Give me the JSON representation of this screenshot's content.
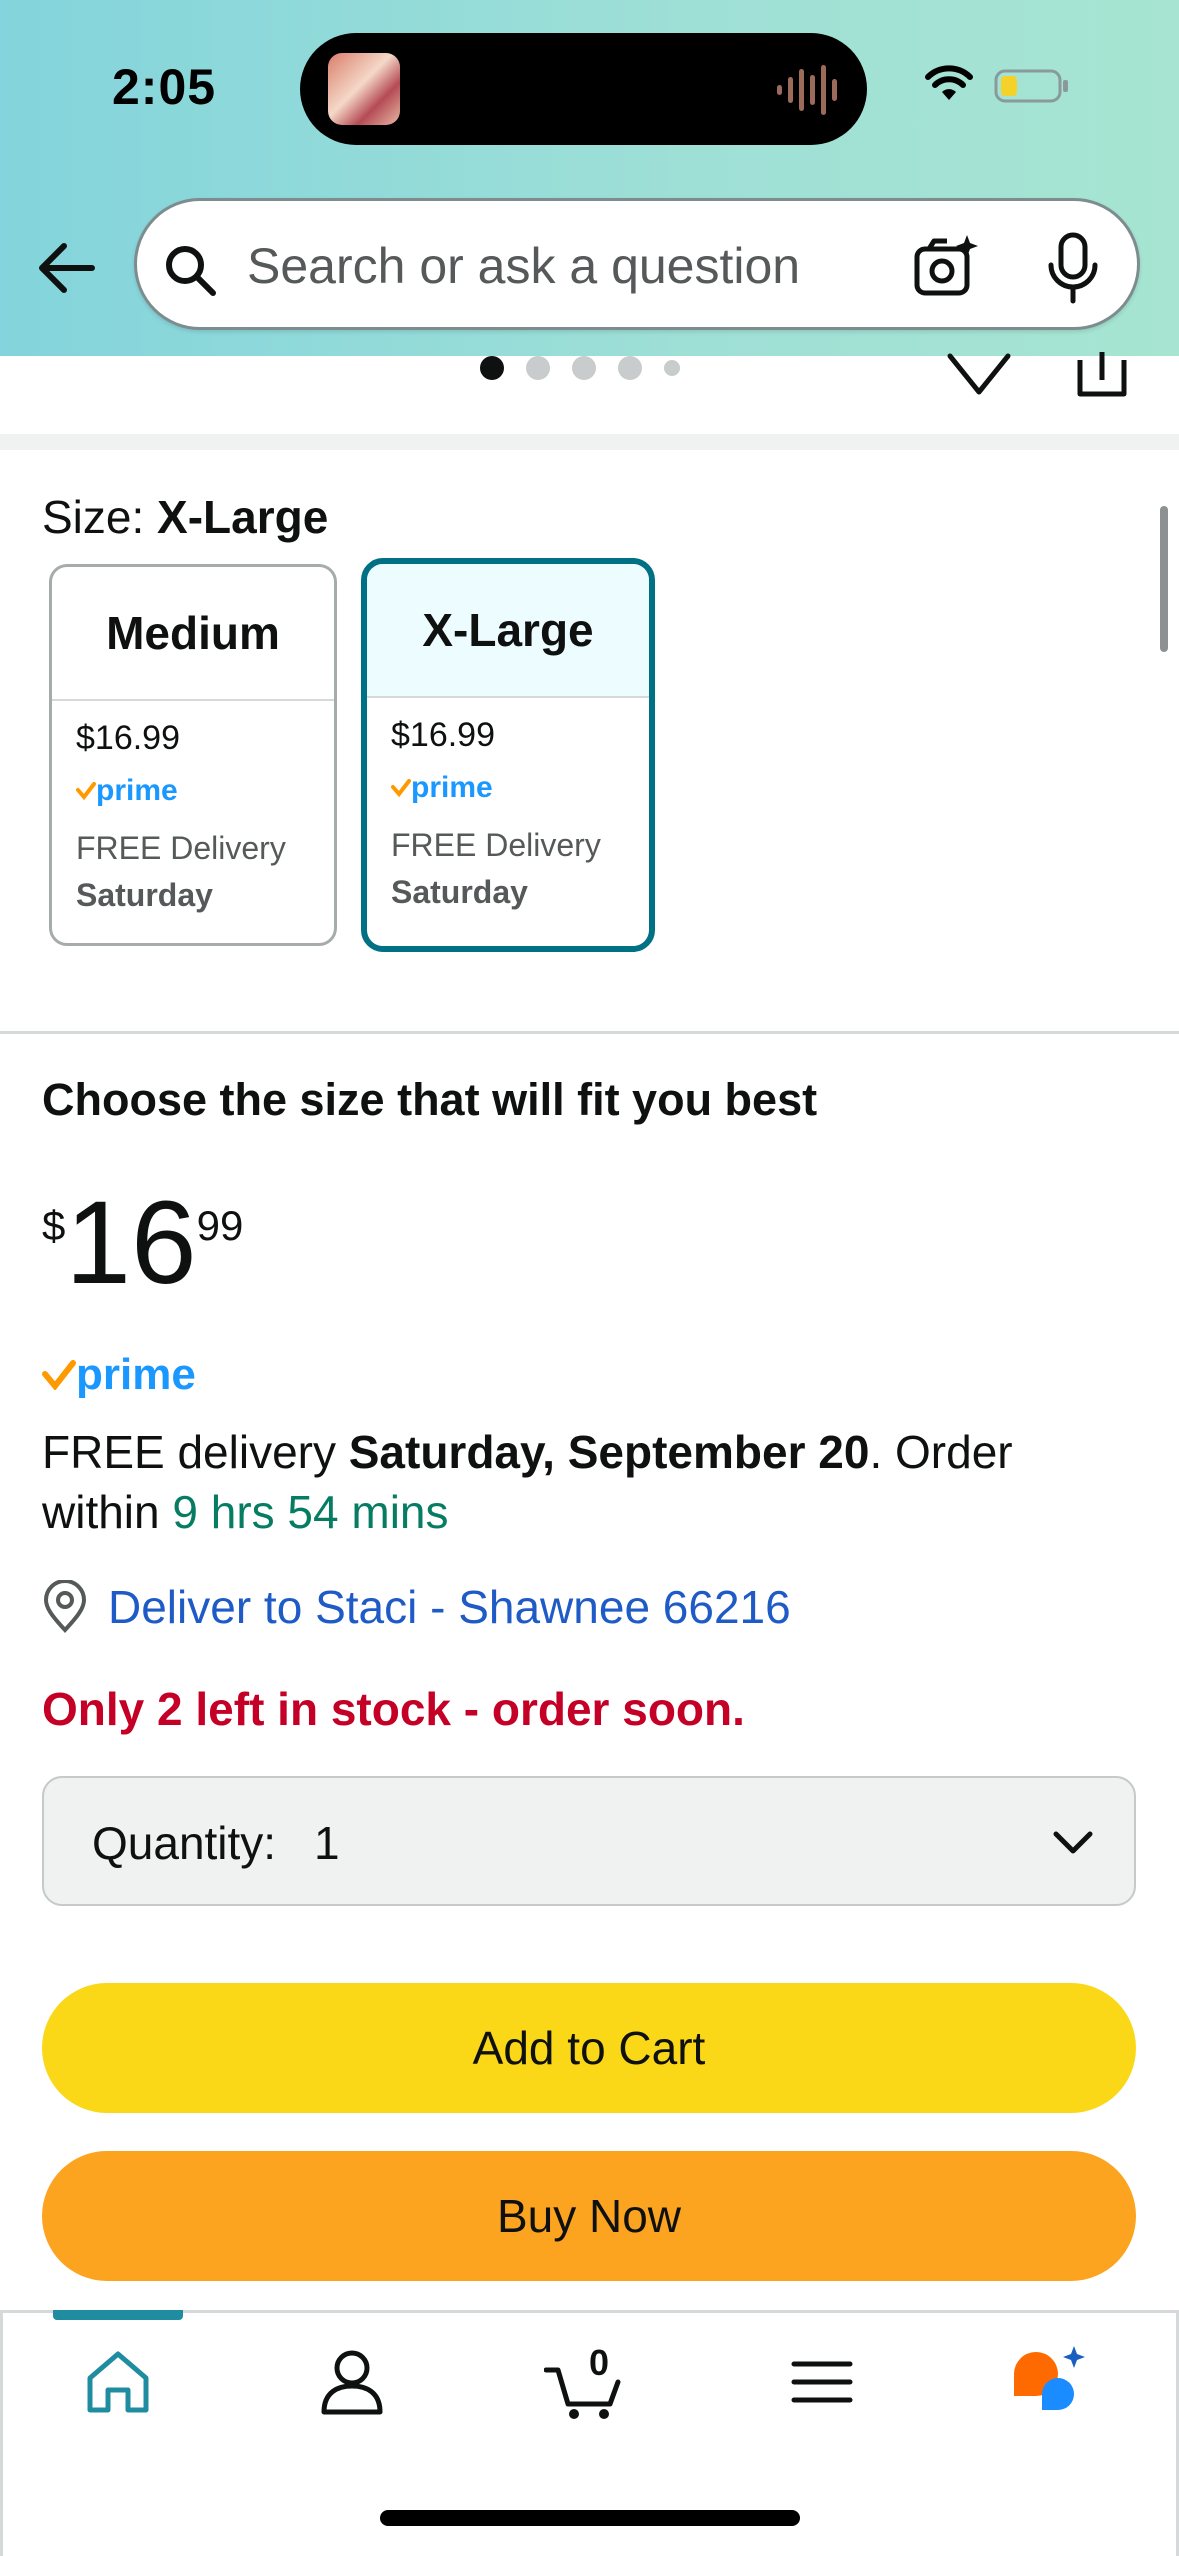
{
  "status_bar": {
    "time": "2:05"
  },
  "search": {
    "placeholder": "Search or ask a question"
  },
  "gallery": {
    "dot_count": 5,
    "active_index": 0
  },
  "size_selector": {
    "label": "Size:",
    "selected": "X-Large",
    "options": [
      {
        "name": "Medium",
        "price": "$16.99",
        "prime": "prime",
        "delivery": "FREE Delivery",
        "day": "Saturday",
        "selected": false
      },
      {
        "name": "X-Large",
        "price": "$16.99",
        "prime": "prime",
        "delivery": "FREE Delivery",
        "day": "Saturday",
        "selected": true
      }
    ]
  },
  "buy_box": {
    "headline": "Choose the size that will fit you best",
    "price": {
      "symbol": "$",
      "whole": "16",
      "fraction": "99"
    },
    "prime": "prime",
    "delivery": {
      "prefix": "FREE delivery ",
      "date": "Saturday, September 20",
      "middle": ". Order within ",
      "countdown": "9 hrs 54 mins"
    },
    "deliver_to": "Deliver to Staci - Shawnee 66216",
    "stock": "Only 2 left in stock - order soon.",
    "quantity": {
      "label": "Quantity:",
      "value": "1"
    },
    "add_to_cart": "Add to Cart",
    "buy_now": "Buy Now"
  },
  "bottom_nav": {
    "items": [
      "home",
      "account",
      "cart",
      "menu",
      "rufus"
    ],
    "active": "home",
    "cart_count": "0"
  },
  "colors": {
    "header_gradient_start": "#83d4dc",
    "header_gradient_end": "#a7e5d2",
    "selected_border": "#007185",
    "add_to_cart": "#fad817",
    "buy_now": "#fca31f",
    "prime_blue": "#1a98ff",
    "prime_check": "#ff9900",
    "countdown_green": "#067d62",
    "stock_red": "#c40026",
    "link_blue": "#1e5bc6"
  },
  "icons": [
    "back-icon",
    "search-icon",
    "camera-icon",
    "mic-icon",
    "heart-icon",
    "share-icon",
    "location-icon",
    "chevron-down-icon",
    "home-icon",
    "account-icon",
    "cart-icon",
    "menu-icon",
    "rufus-icon",
    "wifi-icon",
    "battery-icon"
  ]
}
